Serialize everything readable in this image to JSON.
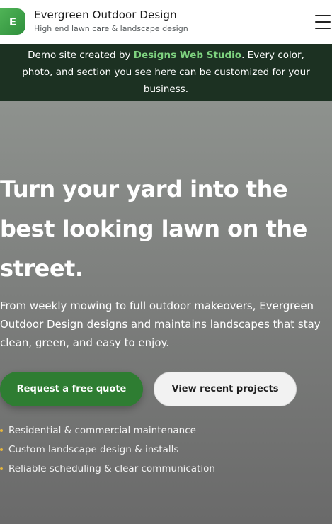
{
  "header": {
    "logo_letter": "E",
    "brand_name": "Evergreen Outdoor Design",
    "tagline": "High end lawn care & landscape design"
  },
  "banner": {
    "prefix": "Demo site created by ",
    "link_text": "Designs Web Studio",
    "suffix": ". Every color, photo, and section you see here can be customized for your business."
  },
  "hero": {
    "title": "Turn your yard into the best looking lawn on the street.",
    "description": "From weekly mowing to full outdoor makeovers, Evergreen Outdoor Design designs and maintains landscapes that stay clean, green, and easy to enjoy.",
    "primary_button": "Request a free quote",
    "secondary_button": "View recent projects",
    "features": [
      "Residential & commercial maintenance",
      "Custom landscape design & installs",
      "Reliable scheduling & clear communication"
    ]
  },
  "colors": {
    "brand_green": "#2e7d32",
    "banner_bg": "#1c3122",
    "banner_link": "#7ed27f",
    "bullet": "#e6b63d"
  },
  "icons": {
    "menu": "hamburger-menu-icon",
    "bullet": "dot-bullet-icon"
  }
}
